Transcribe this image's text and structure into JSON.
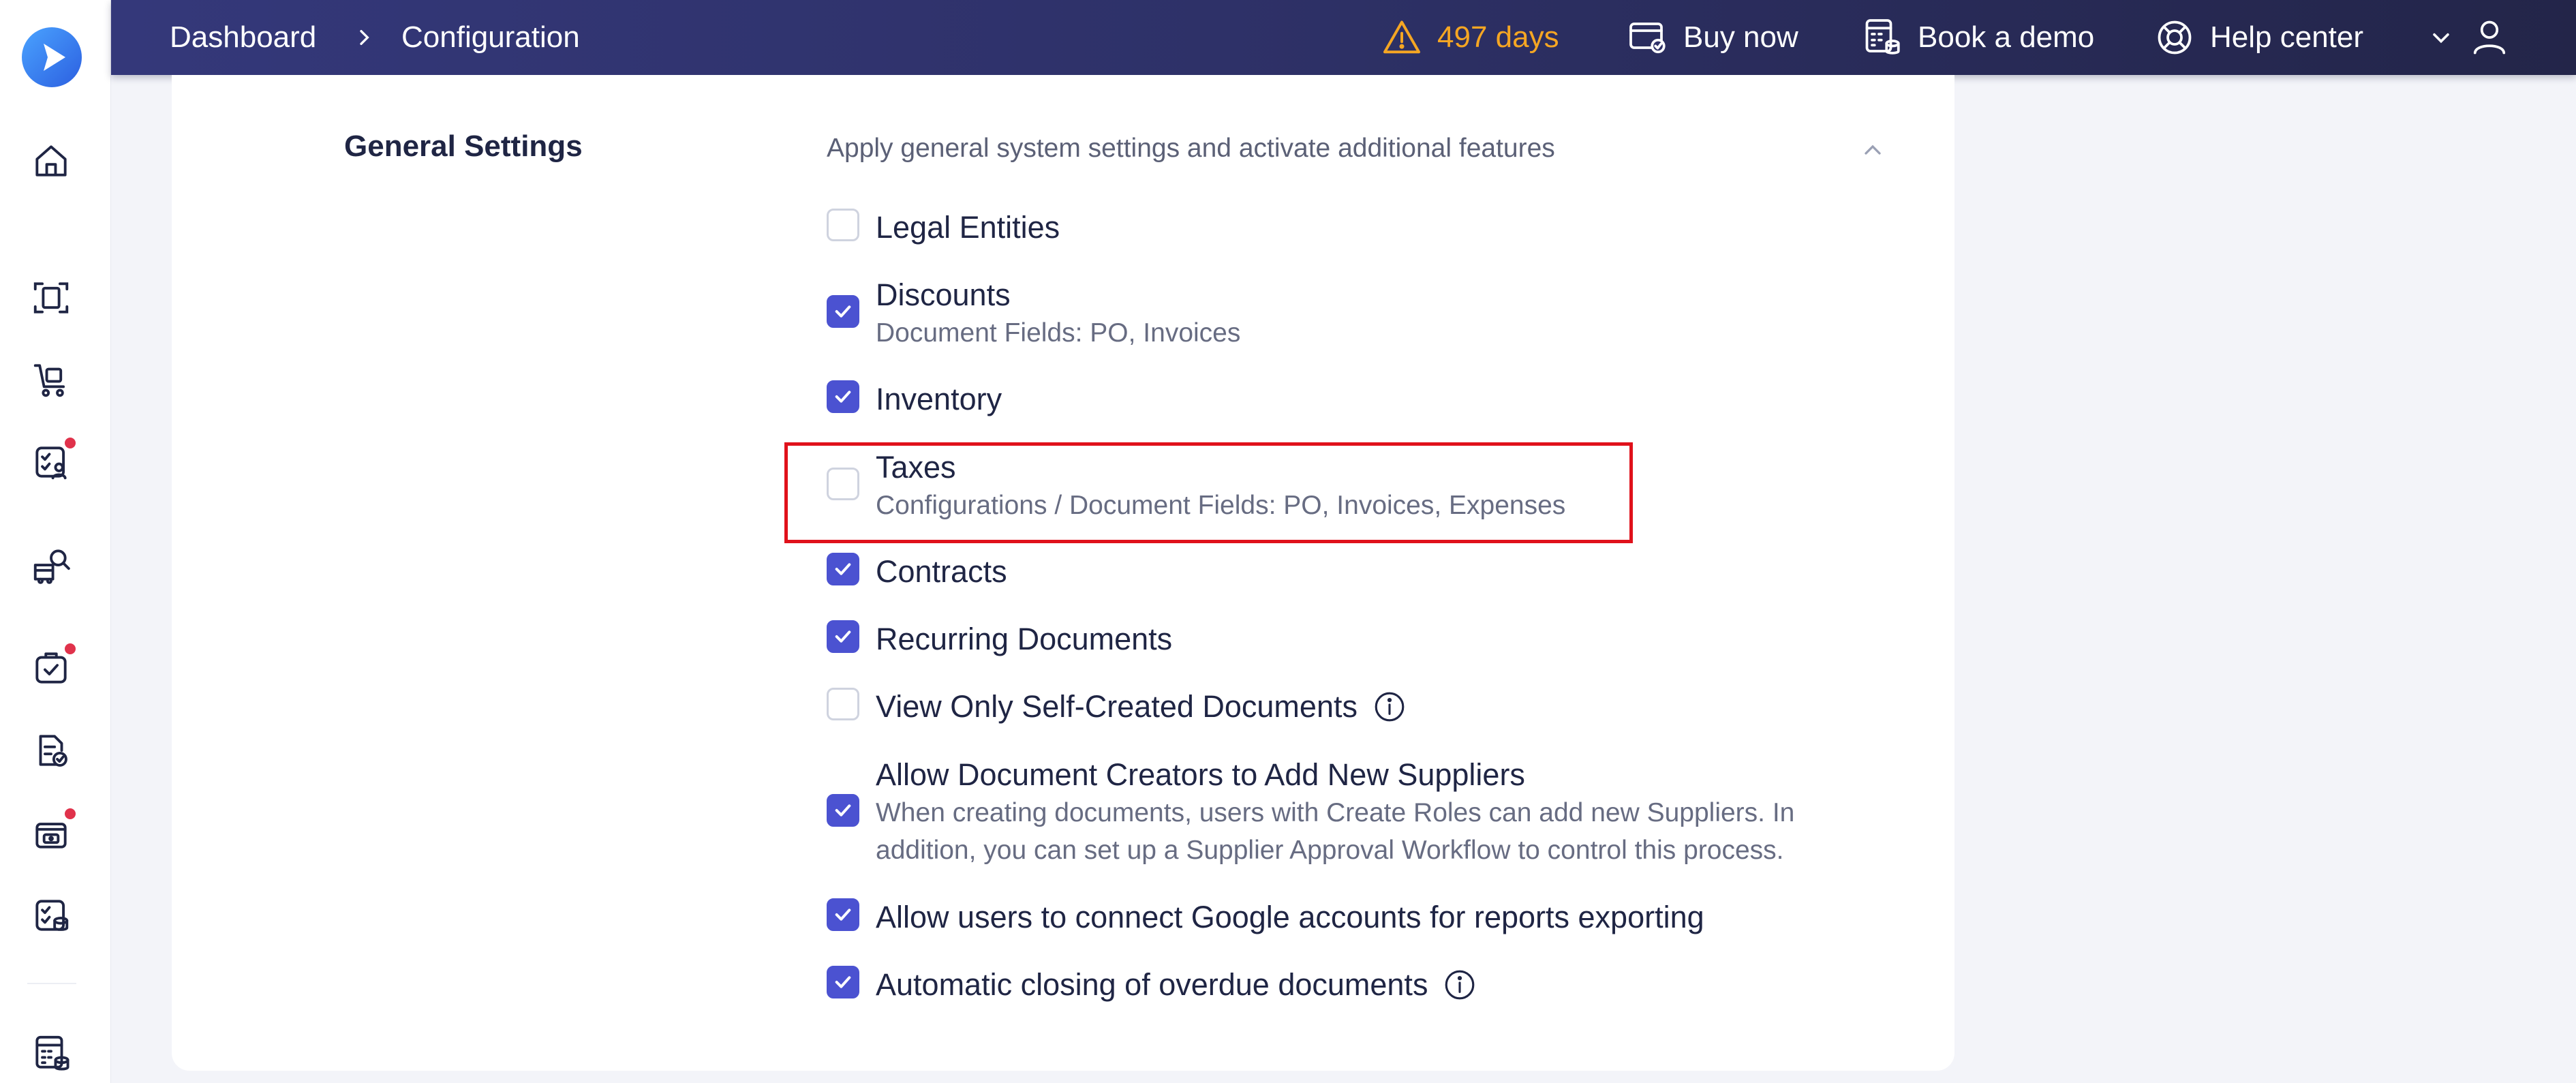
{
  "header": {
    "breadcrumb": [
      "Dashboard",
      "Configuration"
    ],
    "trial_days": "497 days",
    "buy_now": "Buy now",
    "book_demo": "Book a demo",
    "help_center": "Help center"
  },
  "colors": {
    "header_bg": "#2e3168",
    "accent": "#4b52d1",
    "warning": "#f5a623",
    "notification": "#e0324b",
    "highlight": "#e0111b"
  },
  "sidebar": {
    "icons": [
      "home-icon",
      "scan-document-icon",
      "purchase-cart-icon",
      "approvals-icon",
      "supplier-search-icon",
      "tasks-icon",
      "document-check-icon",
      "payments-icon",
      "checklist-icon",
      "calculator-icon"
    ]
  },
  "section": {
    "title": "General Settings",
    "description": "Apply general system settings and activate additional features"
  },
  "options": [
    {
      "label": "Legal Entities",
      "checked": false
    },
    {
      "label": "Discounts",
      "sub": "Document Fields: PO, Invoices",
      "checked": true
    },
    {
      "label": "Inventory",
      "checked": true
    },
    {
      "label": "Taxes",
      "sub": "Configurations / Document Fields: PO, Invoices, Expenses",
      "checked": false
    },
    {
      "label": "Contracts",
      "checked": true
    },
    {
      "label": "Recurring Documents",
      "checked": true
    },
    {
      "label": "View Only Self-Created Documents",
      "checked": false,
      "info": true
    },
    {
      "label": "Allow Document Creators to Add New Suppliers",
      "sub": "When creating documents, users with Create Roles can add new Suppliers. In",
      "sub2": "addition, you can set up a Supplier Approval Workflow to control this process.",
      "checked": true
    },
    {
      "label": "Allow users to connect Google accounts for reports exporting",
      "checked": true
    },
    {
      "label": "Automatic closing of overdue documents",
      "checked": true,
      "info": true
    }
  ]
}
